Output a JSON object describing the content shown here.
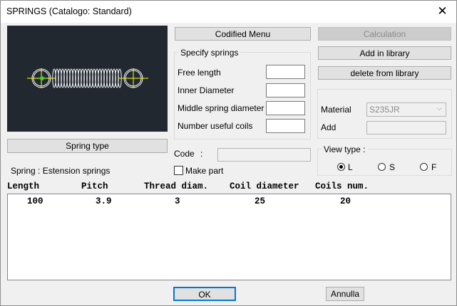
{
  "window": {
    "title": "SPRINGS (Catalogo: Standard)"
  },
  "buttons": {
    "codified_menu": "Codified Menu",
    "calculation": "Calculation",
    "add_in_library": "Add in library",
    "delete_from_library": "delete from library",
    "spring_type": "Spring type",
    "ok": "OK",
    "cancel": "Annulla"
  },
  "specify": {
    "group_label": "Specify springs",
    "free_length": {
      "label": "Free length",
      "value": ""
    },
    "inner_diameter": {
      "label": "Inner Diameter",
      "value": ""
    },
    "middle_diameter": {
      "label": "Middle spring diameter",
      "value": ""
    },
    "useful_coils": {
      "label": "Number useful coils",
      "value": ""
    }
  },
  "code": {
    "label": "Code",
    "separator": ":",
    "value": ""
  },
  "make_part": {
    "label": "Make part",
    "checked": false
  },
  "material": {
    "label": "Material",
    "selected": "S235JR"
  },
  "add": {
    "label": "Add",
    "value": ""
  },
  "view_type": {
    "label": "View type",
    "separator": ":",
    "options": [
      {
        "label": "L",
        "selected": true
      },
      {
        "label": "S",
        "selected": false
      },
      {
        "label": "F",
        "selected": false
      }
    ]
  },
  "spring_info": "Spring : Estension springs",
  "table": {
    "headers": [
      "Length",
      "Pitch",
      "Thread diam.",
      "Coil diameter",
      "Coils num."
    ],
    "rows": [
      [
        "100",
        "3.9",
        "3",
        "25",
        "20"
      ]
    ]
  },
  "colors": {
    "preview_bg": "#212830",
    "spring_line": "#ffffff",
    "axis": "#ffff00",
    "focus_border": "#0078d7"
  }
}
